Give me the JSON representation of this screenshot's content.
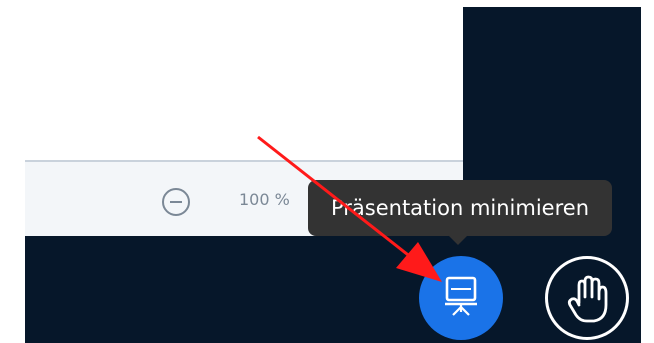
{
  "toolbar": {
    "zoom_level": "100 %"
  },
  "tooltip": {
    "text": "Präsentation minimieren"
  },
  "buttons": {
    "present_icon": "presentation-icon",
    "raise_hand_icon": "hand-icon"
  },
  "colors": {
    "dark_panel": "#06172a",
    "toolbar_bg": "#f3f6f9",
    "tooltip_bg": "#333333",
    "primary_blue": "#1a73e8",
    "annotation_arrow": "#ff1a1a"
  }
}
